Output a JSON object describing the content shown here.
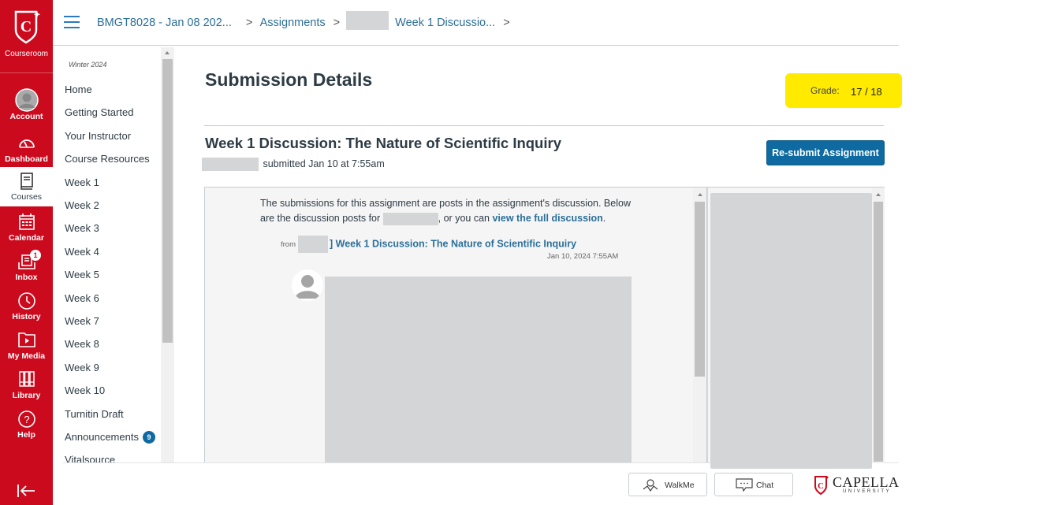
{
  "global_nav": {
    "logo_label": "Courseroom",
    "items": [
      {
        "label": "Account",
        "icon": "account-avatar-icon"
      },
      {
        "label": "Dashboard",
        "icon": "dashboard-gauge-icon"
      },
      {
        "label": "Courses",
        "icon": "book-icon",
        "active": true
      },
      {
        "label": "Calendar",
        "icon": "calendar-icon"
      },
      {
        "label": "Inbox",
        "icon": "inbox-icon",
        "badge": "1"
      },
      {
        "label": "History",
        "icon": "clock-icon"
      },
      {
        "label": "My Media",
        "icon": "media-folder-icon"
      },
      {
        "label": "Library",
        "icon": "library-books-icon"
      },
      {
        "label": "Help",
        "icon": "help-circle-icon"
      }
    ],
    "collapse_icon": "collapse-arrow-icon",
    "brand_color": "#cc0a1e"
  },
  "header": {
    "breadcrumbs": [
      {
        "label": "BMGT8028 - Jan 08 202..."
      },
      {
        "label": "Assignments"
      },
      {
        "label": "Week 1 Discussio..."
      }
    ]
  },
  "course_nav": {
    "term": "Winter 2024",
    "items": [
      {
        "label": "Home"
      },
      {
        "label": "Getting Started"
      },
      {
        "label": "Your Instructor"
      },
      {
        "label": "Course Resources"
      },
      {
        "label": "Week 1"
      },
      {
        "label": "Week 2"
      },
      {
        "label": "Week 3"
      },
      {
        "label": "Week 4"
      },
      {
        "label": "Week 5"
      },
      {
        "label": "Week 6"
      },
      {
        "label": "Week 7"
      },
      {
        "label": "Week 8"
      },
      {
        "label": "Week 9"
      },
      {
        "label": "Week 10"
      },
      {
        "label": "Turnitin Draft"
      },
      {
        "label": "Announcements",
        "badge": "9"
      },
      {
        "label": "Vitalsource"
      }
    ]
  },
  "main": {
    "page_title": "Submission Details",
    "grade_label": "Grade:",
    "grade_value": "17 / 18",
    "grade_highlight_color": "#ffea00",
    "assignment_title": "Week 1 Discussion: The Nature of Scientific Inquiry",
    "submitted_text": "submitted Jan 10 at 7:55am",
    "resubmit_label": "Re-submit Assignment",
    "accent_color": "#0e6aa0",
    "discussion": {
      "intro_part1": "The submissions for this assignment are posts in the assignment's discussion. Below are the discussion posts for",
      "intro_part2": ", or you can",
      "intro_link": "view the full discussion",
      "intro_end": ".",
      "from_label": "from",
      "topic_link": "] Week 1 Discussion: The Nature of Scientific Inquiry",
      "post_date": "Jan 10, 2024 7:55AM"
    }
  },
  "footer": {
    "walkme_label": "WalkMe",
    "chat_label": "Chat",
    "brand_name": "CAPELLA",
    "brand_sub": "UNIVERSITY"
  }
}
